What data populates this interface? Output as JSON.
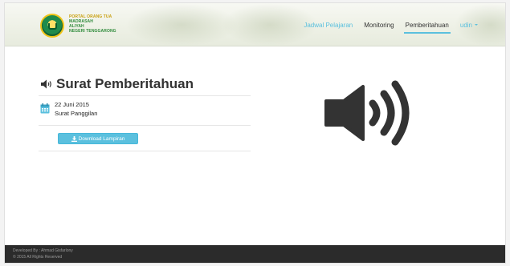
{
  "header": {
    "logo_lines": [
      "PORTAL ORANG TUA",
      "MADRASAH",
      "ALIYAH",
      "NEGERI TENGGARONG"
    ],
    "nav": [
      {
        "label": "Jadwal Pelajaran"
      },
      {
        "label": "Monitoring"
      },
      {
        "label": "Pemberitahuan"
      },
      {
        "label": "udin"
      }
    ],
    "active_nav": "Pemberitahuan"
  },
  "main": {
    "title": "Surat Pemberitahuan",
    "notification": {
      "date": "22 Juni 2015",
      "subject": "Surat Panggilan"
    },
    "download_label": "Download Lampiran"
  },
  "footer": {
    "line1": "Developed By : Ahmad Gisfarlony",
    "line2": "© 2015 All Rights Reserved"
  },
  "colors": {
    "accent": "#5bc0de",
    "footer_bg": "#2b2b2b",
    "title": "#333333",
    "logo_green": "#1f8b4c",
    "logo_gold": "#f0c418"
  },
  "icons": [
    "speaker-icon",
    "calendar-icon",
    "download-icon",
    "speaker-large-icon",
    "caret-down-icon"
  ]
}
